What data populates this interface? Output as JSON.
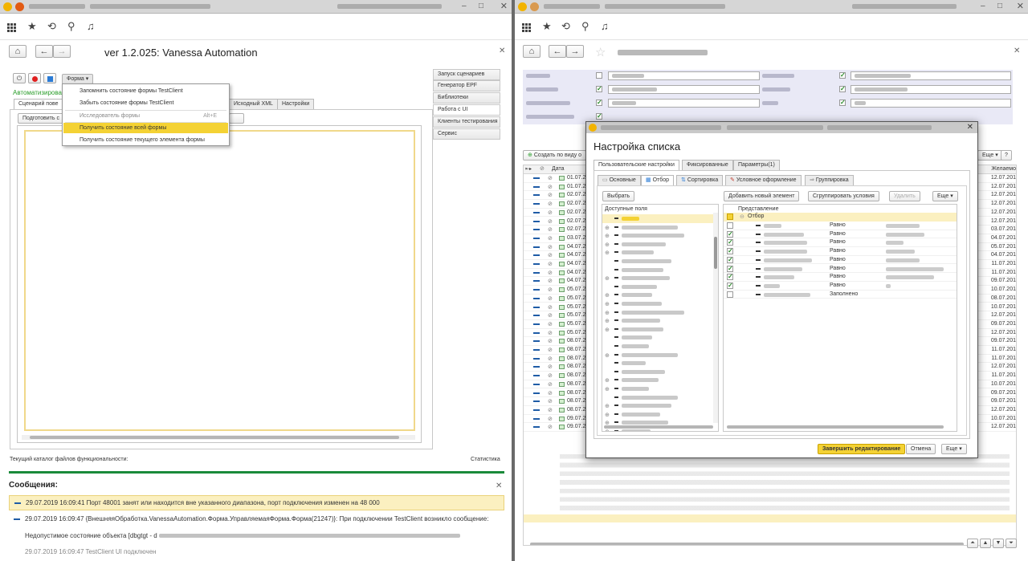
{
  "left_window": {
    "title_blur": "",
    "header_title": "ver 1.2.025: Vanessa Automation",
    "top_button_menu": "Форма",
    "top_green_label": "Автоматизирова",
    "tabs": [
      "Сценарий пове",
      "Исходный XML",
      "Настройки"
    ],
    "prepare_button": "Подготовить с",
    "side_buttons": [
      "Запуск сценариев",
      "Генератор EPF",
      "Библиотеки",
      "Работа с UI",
      "Клиенты тестирования",
      "Сервис"
    ],
    "dropdown_menu": [
      {
        "label": "Запомнить состояние формы TestClient",
        "shortcut": "",
        "state": "normal"
      },
      {
        "label": "Забыть состояние формы TestClient",
        "shortcut": "",
        "state": "normal"
      },
      {
        "label": "Исследователь формы",
        "shortcut": "Alt+E",
        "state": "disabled"
      },
      {
        "label": "Получить состояние всей формы",
        "shortcut": "",
        "state": "highlighted"
      },
      {
        "label": "Получить состояние текущего элемента формы",
        "shortcut": "",
        "state": "normal"
      }
    ],
    "status_left": "Текущий каталог файлов функциональности:",
    "status_right": "Статистика",
    "messages_title": "Сообщения:",
    "messages": [
      {
        "text": "29.07.2019 16:09:41 Порт 48001 занят или находится вне указанного диапазона, порт подключения изменен на 48 000",
        "highlight": true
      },
      {
        "text": "29.07.2019 16:09:47 {ВнешняяОбработка.VanessaAutomation.Форма.УправляемаяФорма.Форма(21247)}: При подключении TestClient возникло сообщение:",
        "highlight": false
      },
      {
        "text": "Недопустимое состояние объекта [dbgtgt - d",
        "highlight": false
      },
      {
        "text": "29.07.2019 16:09:47 TestClient UI подключен",
        "highlight": false
      }
    ]
  },
  "right_window": {
    "create_button": "Создать по виду о",
    "more_button": "Еще",
    "help_button": "?",
    "col_date": "Дата",
    "col_right": "Желаемо",
    "rows": [
      {
        "date": "01.07.201",
        "right": "12.07.201"
      },
      {
        "date": "01.07.201",
        "right": "12.07.201"
      },
      {
        "date": "02.07.201",
        "right": "12.07.201"
      },
      {
        "date": "02.07.201",
        "right": "12.07.201"
      },
      {
        "date": "02.07.201",
        "right": "12.07.201"
      },
      {
        "date": "02.07.201",
        "right": "12.07.201"
      },
      {
        "date": "02.07.201",
        "right": "03.07.201"
      },
      {
        "date": "03.07.201",
        "right": "04.07.201"
      },
      {
        "date": "04.07.201",
        "right": "05.07.201"
      },
      {
        "date": "04.07.201",
        "right": "04.07.201"
      },
      {
        "date": "04.07.201",
        "right": "11.07.201"
      },
      {
        "date": "04.07.201",
        "right": "11.07.201"
      },
      {
        "date": "04.07.201",
        "right": "09.07.201"
      },
      {
        "date": "05.07.201",
        "right": "10.07.201"
      },
      {
        "date": "05.07.201",
        "right": "08.07.201"
      },
      {
        "date": "05.07.201",
        "right": "10.07.201"
      },
      {
        "date": "05.07.201",
        "right": "12.07.201"
      },
      {
        "date": "05.07.201",
        "right": "09.07.201"
      },
      {
        "date": "05.07.201",
        "right": "12.07.201"
      },
      {
        "date": "08.07.201",
        "right": "09.07.201"
      },
      {
        "date": "08.07.201",
        "right": "11.07.201"
      },
      {
        "date": "08.07.201",
        "right": "11.07.201"
      },
      {
        "date": "08.07.201",
        "right": "12.07.201"
      },
      {
        "date": "08.07.201",
        "right": "11.07.201"
      },
      {
        "date": "08.07.201",
        "right": "10.07.201"
      },
      {
        "date": "08.07.201",
        "right": "09.07.201"
      },
      {
        "date": "08.07.201",
        "right": "09.07.201"
      },
      {
        "date": "08.07.201",
        "right": "12.07.201"
      },
      {
        "date": "09.07.201",
        "right": "10.07.201"
      },
      {
        "date": "09.07.201",
        "right": "12.07.201"
      }
    ]
  },
  "dialog": {
    "title": "Настройка списка",
    "top_tabs": [
      "Пользовательские настройки",
      "Фиксированные",
      "Параметры(1)"
    ],
    "sub_tabs": [
      "Основные",
      "Отбор",
      "Сортировка",
      "Условное оформление",
      "Группировка"
    ],
    "select_button": "Выбрать",
    "add_button": "Добавить новый элемент",
    "group_button": "Сгруппировать условия",
    "delete_button": "Удалить",
    "more_button": "Еще",
    "available_fields": "Доступные поля",
    "presentation": "Представление",
    "filter_root": "Отбор",
    "filter_rows": [
      {
        "checked": false,
        "cmp": "Равно"
      },
      {
        "checked": true,
        "cmp": "Равно"
      },
      {
        "checked": true,
        "cmp": "Равно"
      },
      {
        "checked": true,
        "cmp": "Равно"
      },
      {
        "checked": true,
        "cmp": "Равно"
      },
      {
        "checked": true,
        "cmp": "Равно"
      },
      {
        "checked": true,
        "cmp": "Равно"
      },
      {
        "checked": true,
        "cmp": "Равно"
      },
      {
        "checked": false,
        "cmp": "Заполнено"
      }
    ],
    "finish_button": "Завершить редактирование",
    "cancel_button": "Отмена",
    "footer_more": "Еще",
    "accent": "#f4d234"
  }
}
